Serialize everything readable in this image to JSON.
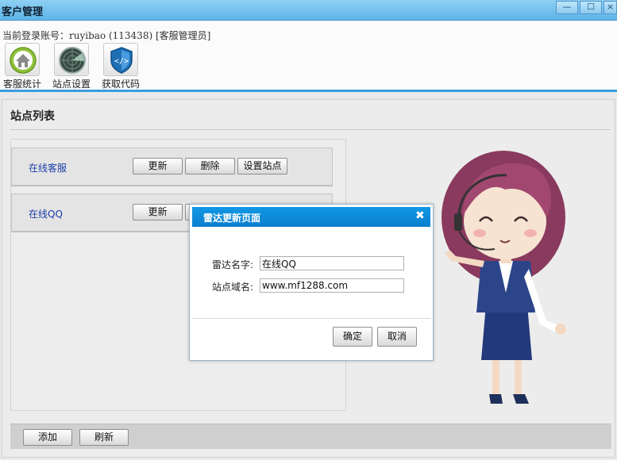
{
  "window": {
    "title": "客户管理",
    "min_glyph": "—",
    "max_glyph": "☐",
    "close_glyph": "×"
  },
  "header": {
    "account_text": "当前登录账号：ruyibao (113438) [客服管理员]",
    "tools": [
      {
        "label": "客服统计",
        "icon": "home-icon"
      },
      {
        "label": "站点设置",
        "icon": "radar-icon"
      },
      {
        "label": "获取代码",
        "icon": "code-shield-icon"
      }
    ]
  },
  "main": {
    "section_title": "站点列表",
    "sites": [
      {
        "name": "在线客服",
        "buttons": [
          "更新",
          "删除",
          "设置站点"
        ]
      },
      {
        "name": "在线QQ",
        "buttons": [
          "更新"
        ]
      }
    ],
    "bottom_buttons": {
      "add": "添加",
      "refresh": "刷新"
    }
  },
  "dialog": {
    "title": "雷达更新页面",
    "close_glyph": "✖",
    "radar_name_label": "雷达名字:",
    "radar_name_value": "在线QQ",
    "domain_label": "站点域名:",
    "domain_value": "www.mf1288.com",
    "ok_label": "确定",
    "cancel_label": "取消"
  },
  "colors": {
    "accent_blue": "#0a86d6",
    "link_blue": "#1b3ea8",
    "titlebar_blue": "#5db4e8"
  }
}
